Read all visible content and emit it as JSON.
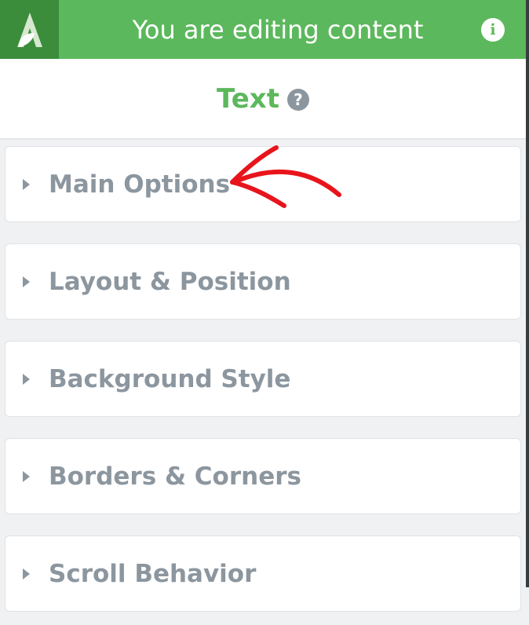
{
  "header": {
    "title": "You are editing content",
    "logo_icon": "leaf-a-logo-icon",
    "info_icon": "info-icon",
    "info_glyph": "i"
  },
  "element": {
    "title": "Text",
    "help_icon": "question-icon",
    "help_glyph": "?"
  },
  "sections": [
    {
      "label": "Main Options"
    },
    {
      "label": "Layout & Position"
    },
    {
      "label": "Background Style"
    },
    {
      "label": "Borders & Corners"
    },
    {
      "label": "Scroll Behavior"
    }
  ],
  "colors": {
    "accent_green": "#5cb85c",
    "logo_green": "#3b8d3b",
    "label_gray": "#8c969f",
    "annotation_red": "#e8141c"
  }
}
